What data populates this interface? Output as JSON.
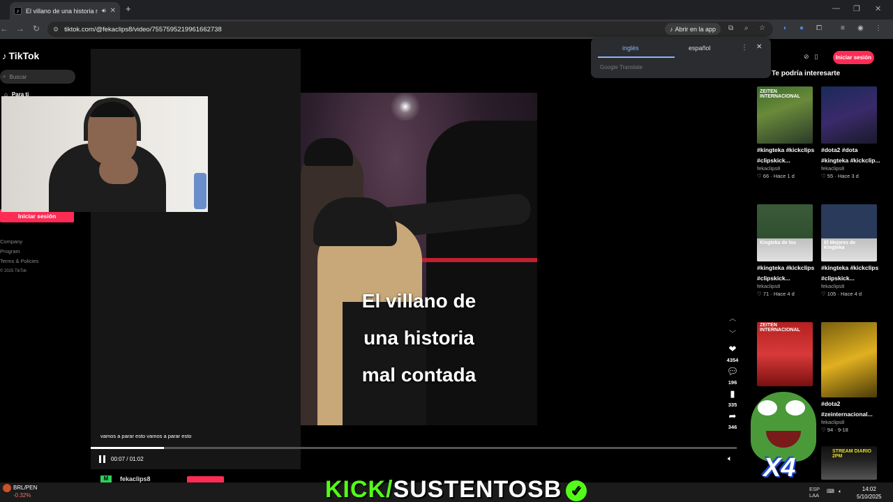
{
  "browser": {
    "tab_title": "El villano de una historia ma",
    "tab_favicon": "tiktok-icon",
    "url": "tiktok.com/@fekaclips8/video/7557595219961662738",
    "open_in_app": "Abrir en la app"
  },
  "translate_popup": {
    "tabs": [
      "inglés",
      "español"
    ],
    "active_tab": "inglés",
    "brand": "Google Translate"
  },
  "sidebar": {
    "logo": "TikTok",
    "search_placeholder": "Buscar",
    "nav_first": "Para ti",
    "login": "Iniciar sesión",
    "links": [
      "Company",
      "Program",
      "Terms & Policies"
    ],
    "copyright": "© 2025 TikTok"
  },
  "video": {
    "caption_lines": [
      "El villano de",
      "una historia",
      "mal contada"
    ],
    "subtitle": "vamos a parar esto vamos a parar esto",
    "current_time": "00:07",
    "duration": "01:02",
    "time_display": "00:07 / 01:02",
    "progress": 0.113,
    "author": "fekaclips8"
  },
  "actions": {
    "likes": "4354",
    "comments": "196",
    "saves": "335",
    "shares": "346"
  },
  "right_panel": {
    "login": "Iniciar sesión",
    "title": "Te podría interesarte",
    "cards": [
      {
        "caption": "#kingteka #kickclips",
        "caption2": "#clipskick...",
        "user": "fekaclips8",
        "meta": "♡ 66 · Hace 1 d",
        "label": "ZEITEN INTERNACIONAL"
      },
      {
        "caption": "#dota2 #dota",
        "caption2": "#kingteka #kickclip...",
        "user": "fekaclips8",
        "meta": "♡ 55 · Hace 3 d",
        "label": ""
      },
      {
        "caption": "#kingteka #kickclips",
        "caption2": "#clipskick...",
        "user": "fekaclips8",
        "meta": "♡ 71 · Hace 4 d",
        "label": "Kingteka de los"
      },
      {
        "caption": "#kingteka #kickclips",
        "caption2": "#clipskick...",
        "user": "fekaclips8",
        "meta": "♡ 105 · Hace 4 d",
        "label": "El Mejores de Kingteka"
      },
      {
        "caption": "",
        "caption2": "",
        "user": "",
        "meta": "",
        "label": "ZEITEN INTERNACIONAL"
      },
      {
        "caption": "#dota2",
        "caption2": "#zeinternacional...",
        "user": "fekaclips8",
        "meta": "♡ 94 · 9-18",
        "label": ""
      },
      {
        "caption": "",
        "caption2": "",
        "user": "",
        "meta": "",
        "label": "STREAM DIARIO 2PM"
      }
    ]
  },
  "overlay": {
    "kick_prefix": "KICK/",
    "kick_name": "SUSTENTOSB",
    "peepo_badge": "X4"
  },
  "taskbar": {
    "ticker_symbol": "BRL/PEN",
    "ticker_change": "-0.32%",
    "lang": "ESP",
    "lang2": "LAA",
    "time": "14:02",
    "date": "5/10/2025"
  },
  "colors": {
    "tiktok_red": "#fe2c55",
    "kick_green": "#53fc18",
    "translate_blue": "#8ab4f8"
  }
}
